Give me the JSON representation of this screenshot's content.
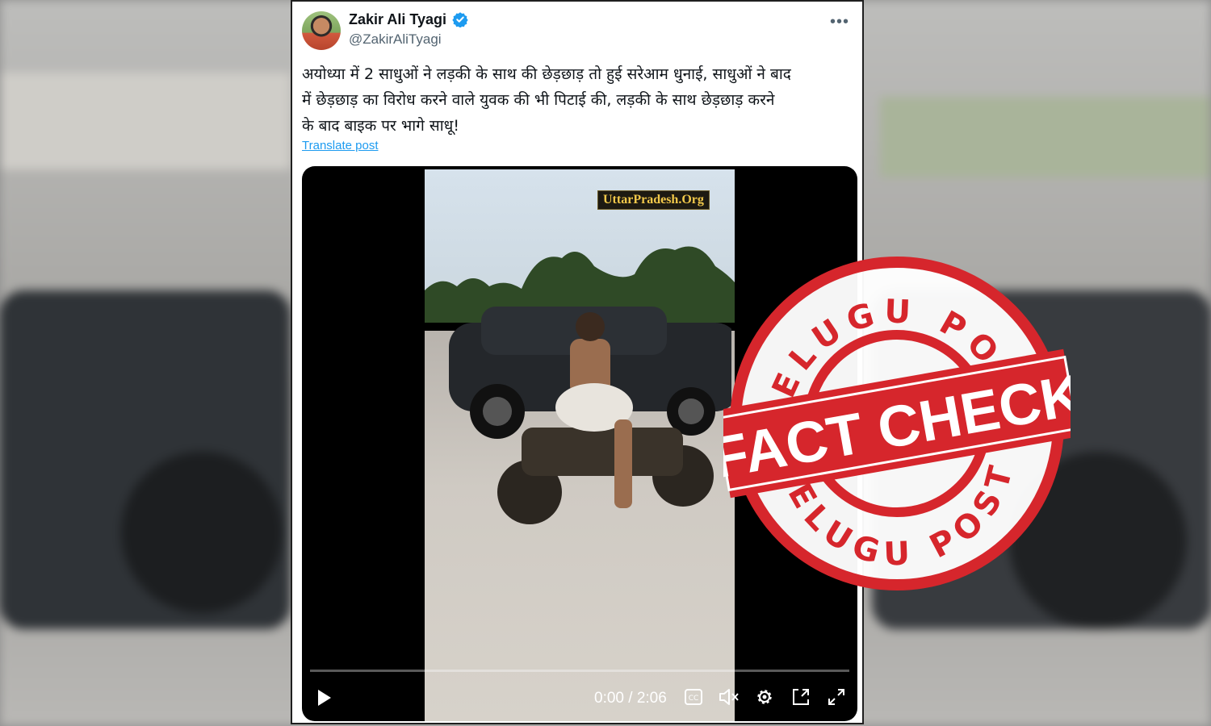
{
  "tweet": {
    "author_name": "Zakir Ali Tyagi",
    "author_handle": "@ZakirAliTyagi",
    "more_icon": "more-horizontal-icon",
    "verified_icon": "verified-badge-icon",
    "text_lines": [
      "अयोध्या में 2 साधुओं ने लड़की के साथ की छेड़छाड़ तो हुई सरेआम धुनाई, साधुओं ने बाद",
      "में छेड़छाड़ का विरोध करने वाले युवक की भी पिटाई की, लड़की के साथ छेड़छाड़ करने",
      "के बाद बाइक पर भागे साधू!"
    ],
    "translate_label": "Translate post"
  },
  "video": {
    "watermark": "UttarPradesh.Org",
    "time_display": "0:00 / 2:06",
    "progress": 0.0,
    "icons": {
      "play": "play-icon",
      "captions": "captions-icon",
      "mute": "volume-muted-icon",
      "settings": "settings-gear-icon",
      "popout": "popout-icon",
      "fullscreen": "fullscreen-icon"
    }
  },
  "stamp": {
    "top_text": "TELUGU POST",
    "main_text": "FACT CHECK",
    "bottom_text": "TELUGU POST",
    "color": "#d6262c"
  },
  "colors": {
    "link": "#1d9bf0",
    "verified": "#1d9bf0",
    "secondary_text": "#536471"
  }
}
